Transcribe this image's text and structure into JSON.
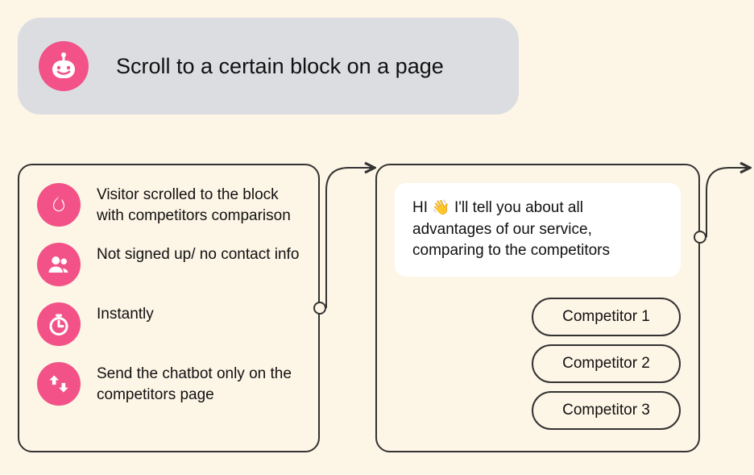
{
  "header": {
    "title": "Scroll to a certain block on a page",
    "icon": "bot-icon"
  },
  "triggers": [
    {
      "icon": "flame-icon",
      "text": "Visitor scrolled to the block with competitors comparison"
    },
    {
      "icon": "users-icon",
      "text": "Not signed up/\nno contact info"
    },
    {
      "icon": "stopwatch-icon",
      "text": "Instantly"
    },
    {
      "icon": "arrows-icon",
      "text": "Send the chatbot only on the competitors page"
    }
  ],
  "response": {
    "message_prefix": "HI ",
    "message_emoji": "👋",
    "message_suffix": " I'll tell you about all advantages of our service, comparing to the competitors",
    "options": [
      {
        "label": "Competitor 1"
      },
      {
        "label": "Competitor 2"
      },
      {
        "label": "Competitor 3"
      }
    ]
  }
}
